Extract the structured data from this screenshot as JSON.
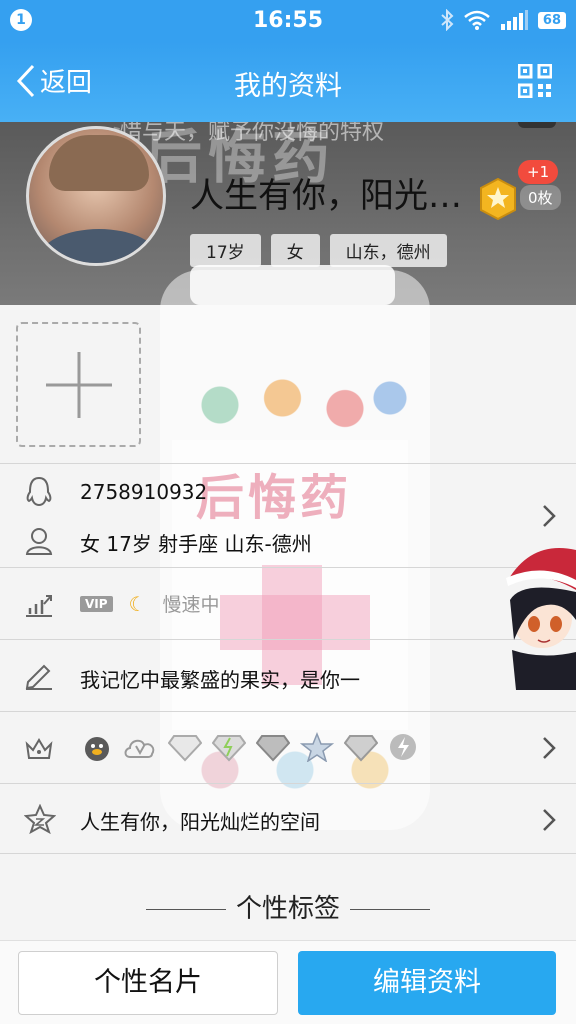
{
  "status_bar": {
    "notification_count": "1",
    "time": "16:55",
    "battery": "68"
  },
  "title_bar": {
    "back_label": "返回",
    "title": "我的资料"
  },
  "cover": {
    "background_text": "的后悔药",
    "background_subtext": "惜与天，赋予你没悔的特权",
    "nickname": "人生有你，阳光…",
    "badge_plus": "+1",
    "badge_count": "0枚",
    "tags": [
      "17岁",
      "女",
      "山东，德州"
    ]
  },
  "jar": {
    "label_text": "后悔药"
  },
  "profile": {
    "qq_number": "2758910932",
    "basic_info": "女  17岁  射手座  山东-德州",
    "vip_label": "VIP",
    "speed_label": "慢速中",
    "signature": "我记忆中最繁盛的果实，是你一",
    "space_name": "人生有你，阳光灿烂的空间"
  },
  "tag_section": {
    "title": "个性标签"
  },
  "buttons": {
    "card": "个性名片",
    "edit": "编辑资料"
  },
  "colors": {
    "primary": "#35a0f0",
    "edit_button": "#28a8f0",
    "badge_red": "#f24b3d"
  }
}
